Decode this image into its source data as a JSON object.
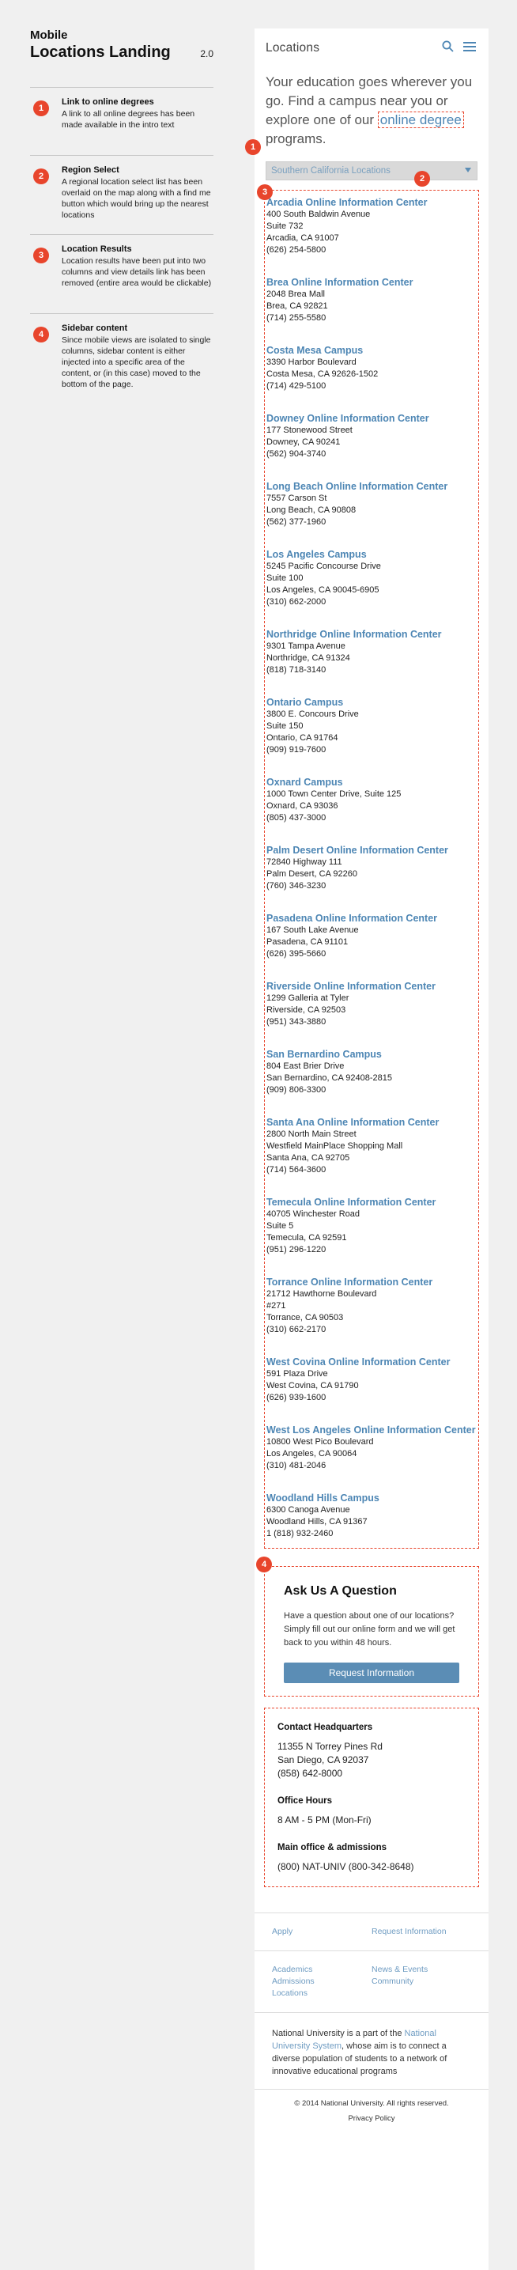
{
  "doc": {
    "kicker": "Mobile",
    "title": "Locations Landing",
    "version": "2.0"
  },
  "notes": [
    {
      "num": "1",
      "title": "Link to online degrees",
      "text": "A link to all online degrees has been made available in the intro text"
    },
    {
      "num": "2",
      "title": "Region Select",
      "text": "A regional location select list has been overlaid on the map along with a find me button which would bring up the nearest locations"
    },
    {
      "num": "3",
      "title": "Location Results",
      "text": "Location results have been put into two columns and view details link has been removed (entire area would be clickable)"
    },
    {
      "num": "4",
      "title": "Sidebar content",
      "text": "Since mobile views are isolated to single columns, sidebar content is either injected into a specific area of the content, or (in this case) moved to the bottom of the page."
    }
  ],
  "header": {
    "brand": "Locations",
    "search_icon": "search-icon",
    "menu_icon": "menu-icon"
  },
  "intro": {
    "text_before": "Your education goes wherever you go. Find a campus near you or explore one of our ",
    "link": "online degree",
    "text_after": " programs."
  },
  "region_select": {
    "value": "Southern California Locations",
    "icon": "chevron-down-icon"
  },
  "badges": {
    "b1": "1",
    "b2": "2",
    "b3": "3",
    "b4": "4"
  },
  "locations": [
    {
      "name": "Arcadia Online Information Center",
      "lines": [
        "400 South Baldwin Avenue",
        "Suite 732",
        "Arcadia, CA 91007",
        "(626) 254-5800"
      ]
    },
    {
      "name": "Brea Online Information Center",
      "lines": [
        "2048 Brea Mall",
        "Brea, CA 92821",
        "(714) 255-5580"
      ]
    },
    {
      "name": "Costa Mesa Campus",
      "lines": [
        "3390 Harbor Boulevard",
        "Costa Mesa, CA 92626-1502",
        "(714) 429-5100"
      ]
    },
    {
      "name": "Downey Online Information Center",
      "lines": [
        "177 Stonewood Street",
        "Downey, CA 90241",
        "(562) 904-3740"
      ]
    },
    {
      "name": "Long Beach Online Information Center",
      "lines": [
        "7557 Carson St",
        "Long Beach, CA 90808",
        "(562) 377-1960"
      ]
    },
    {
      "name": "Los Angeles Campus",
      "lines": [
        "5245 Pacific Concourse Drive",
        "Suite 100",
        "Los Angeles, CA 90045-6905",
        "(310) 662-2000"
      ]
    },
    {
      "name": "Northridge Online Information Center",
      "lines": [
        "9301 Tampa Avenue",
        "Northridge, CA 91324",
        "(818) 718-3140"
      ]
    },
    {
      "name": "Ontario Campus",
      "lines": [
        "3800 E. Concours Drive",
        "Suite 150",
        "Ontario, CA 91764",
        "(909) 919-7600"
      ]
    },
    {
      "name": "Oxnard Campus",
      "lines": [
        "1000 Town Center Drive, Suite 125",
        "Oxnard, CA 93036",
        "(805) 437-3000"
      ]
    },
    {
      "name": "Palm Desert Online Information Center",
      "lines": [
        "72840 Highway 111",
        "Palm Desert, CA 92260",
        "(760) 346-3230"
      ]
    },
    {
      "name": "Pasadena Online Information Center",
      "lines": [
        "167 South Lake Avenue",
        "Pasadena, CA 91101",
        "(626) 395-5660"
      ]
    },
    {
      "name": "Riverside Online Information Center",
      "lines": [
        "1299 Galleria at Tyler",
        "Riverside, CA 92503",
        "(951) 343-3880"
      ]
    },
    {
      "name": "San Bernardino Campus",
      "lines": [
        "804 East Brier Drive",
        "San Bernardino, CA 92408-2815",
        "(909) 806-3300"
      ]
    },
    {
      "name": "Santa Ana Online Information Center",
      "lines": [
        "2800 North Main Street",
        "Westfield MainPlace Shopping Mall",
        "Santa Ana, CA 92705",
        "(714) 564-3600"
      ]
    },
    {
      "name": "Temecula Online Information Center",
      "lines": [
        "40705 Winchester Road",
        "Suite 5",
        "Temecula, CA 92591",
        "(951) 296-1220"
      ]
    },
    {
      "name": "Torrance Online Information Center",
      "lines": [
        "21712 Hawthorne Boulevard",
        "#271",
        "Torrance, CA 90503",
        "(310) 662-2170"
      ]
    },
    {
      "name": "West Covina Online Information Center",
      "lines": [
        "591 Plaza Drive",
        "West Covina, CA 91790",
        "(626) 939-1600"
      ]
    },
    {
      "name": "West Los Angeles Online Information Center",
      "lines": [
        "10800 West Pico Boulevard",
        "Los Angeles, CA 90064",
        "(310) 481-2046"
      ]
    },
    {
      "name": "Woodland Hills Campus",
      "lines": [
        "6300 Canoga Avenue",
        "Woodland Hills, CA 91367",
        "1 (818) 932-2460"
      ]
    }
  ],
  "ask": {
    "title": "Ask Us A Question",
    "text": "Have a question about one of our locations? Simply fill out our online form and we will get back to you within 48 hours.",
    "button": "Request Information"
  },
  "hq": {
    "title": "Contact Headquarters",
    "address1": "11355 N Torrey Pines Rd",
    "address2": "San Diego, CA 92037",
    "phone": "(858) 642-8000",
    "hours_title": "Office Hours",
    "hours": "8 AM - 5 PM (Mon-Fri)",
    "main_title": "Main office & admissions",
    "main_phone": "(800) NAT-UNIV (800-342-8648)"
  },
  "footer": {
    "apply": "Apply",
    "request": "Request Information",
    "links_left": [
      "Academics",
      "Admissions",
      "Locations"
    ],
    "links_right": [
      "News & Events",
      "Community"
    ],
    "about_before": "National University is a part of the ",
    "about_link": "National University System",
    "about_after": ", whose aim is to connect a diverse population of students to a network of innovative educational programs",
    "copyright": "© 2014 National University. All rights reserved.",
    "privacy": "Privacy Policy"
  },
  "colors": {
    "accent": "#e8452c",
    "link": "#4d86b4",
    "button": "#5b8db5"
  }
}
